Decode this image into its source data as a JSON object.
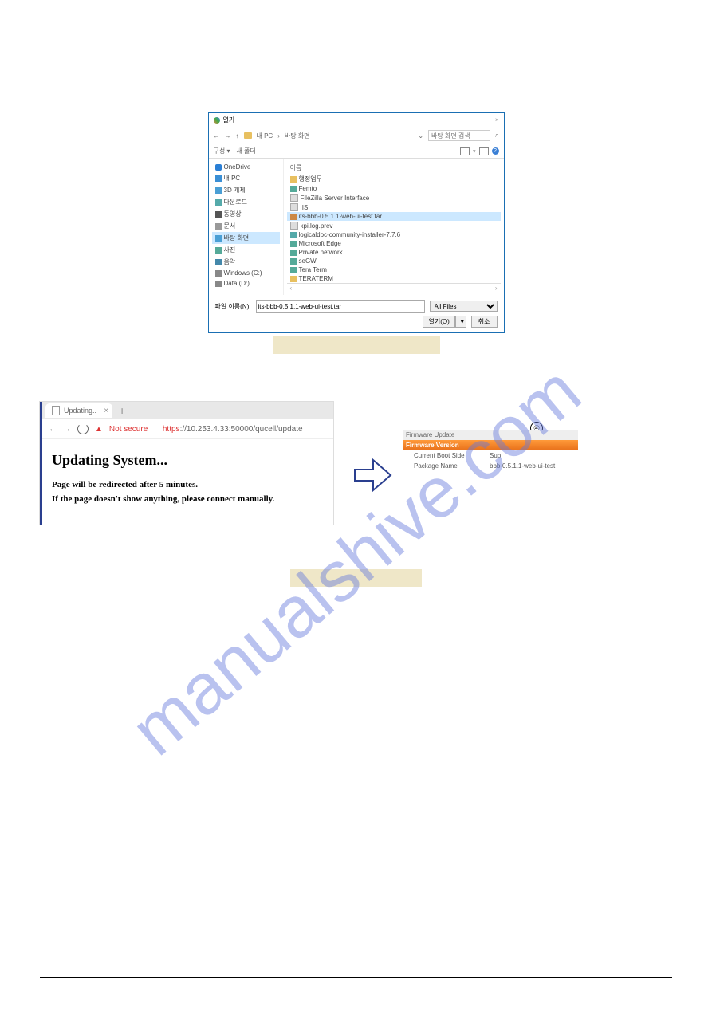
{
  "watermark": "manualshive.com",
  "file_dialog": {
    "title": "열기",
    "close": "×",
    "nav": {
      "back": "←",
      "forward": "→",
      "up": "↑",
      "path1": "내 PC",
      "sep": "›",
      "path2": "바탕 화면",
      "search_placeholder": "바탕 화면 검색",
      "search_icon": "⌕"
    },
    "toolbar": {
      "organize": "구성 ▾",
      "new_folder": "새 폴더",
      "help": "?"
    },
    "sidebar": [
      {
        "icon": "onedrive",
        "label": "OneDrive"
      },
      {
        "icon": "pc",
        "label": "내 PC"
      },
      {
        "icon": "box3d",
        "label": "3D 개체"
      },
      {
        "icon": "download",
        "label": "다운로드"
      },
      {
        "icon": "video",
        "label": "동영상"
      },
      {
        "icon": "doc",
        "label": "문서"
      },
      {
        "icon": "desktop",
        "label": "바탕 화면",
        "active": true
      },
      {
        "icon": "pic",
        "label": "사진"
      },
      {
        "icon": "music",
        "label": "음악"
      },
      {
        "icon": "drive-c",
        "label": "Windows (C:)"
      },
      {
        "icon": "drive-d",
        "label": "Data (D:)"
      }
    ],
    "list_header": "이름",
    "list": [
      {
        "icon": "folder",
        "label": "행정업무"
      },
      {
        "icon": "shortcut",
        "label": "Femto"
      },
      {
        "icon": "file",
        "label": "FileZilla Server Interface"
      },
      {
        "icon": "file",
        "label": "IIS"
      },
      {
        "icon": "tar",
        "label": "its-bbb-0.5.1.1-web-ui-test.tar",
        "selected": true
      },
      {
        "icon": "file",
        "label": "kpi.log.prev"
      },
      {
        "icon": "exe",
        "label": "logicaldoc-community-installer-7.7.6"
      },
      {
        "icon": "shortcut",
        "label": "Microsoft Edge"
      },
      {
        "icon": "shortcut",
        "label": "Private network"
      },
      {
        "icon": "shortcut",
        "label": "seGW"
      },
      {
        "icon": "shortcut",
        "label": "Tera Term"
      },
      {
        "icon": "folder",
        "label": "TERATERM"
      }
    ],
    "footer": {
      "name_label": "파일 이름(N):",
      "name_value": "its-bbb-0.5.1.1-web-ui-test.tar",
      "filter": "All Files",
      "open": "열기(O)",
      "cancel": "취소"
    }
  },
  "browser": {
    "tab_title": "Updating..",
    "tab_close": "×",
    "new_tab": "+",
    "nav": {
      "back": "←",
      "forward": "→"
    },
    "warn": "▲",
    "not_secure": "Not secure",
    "url_https": "https",
    "url_rest": "://10.253.4.33:50000/qucell/update",
    "h2": "Updating System...",
    "p1": "Page will be redirected after 5 minutes.",
    "p2": "If the page doesn't show anything, please connect manually."
  },
  "firmware": {
    "section": "Firmware Update",
    "header": "Firmware Version",
    "row1_label": "Current Boot Side",
    "row1_val": "Sub",
    "row2_label": "Package Name",
    "row2_val": "bbb-0.5.1.1-web-ui-test",
    "marker": "④"
  }
}
